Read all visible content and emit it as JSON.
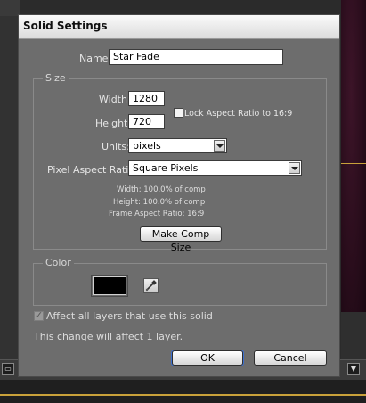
{
  "dialog": {
    "title": "Solid Settings",
    "name_label": "Name:",
    "name_value": "Star Fade"
  },
  "size": {
    "group_label": "Size",
    "width_label": "Width:",
    "width_value": "1280",
    "height_label": "Height:",
    "height_value": "720",
    "lock_label": "Lock Aspect Ratio to 16:9",
    "lock_checked": false,
    "units_label": "Units:",
    "units_value": "pixels",
    "par_label": "Pixel Aspect Ratio:",
    "par_value": "Square Pixels",
    "info_width": "Width:   100.0% of comp",
    "info_height": "Height:   100.0% of comp",
    "info_frame": "Frame Aspect Ratio: 16:9",
    "make_comp_size_label": "Make Comp Size"
  },
  "color": {
    "group_label": "Color",
    "swatch_color": "#000000",
    "eyedropper_icon": "eyedropper-icon"
  },
  "footer": {
    "affect_label": "Affect all layers that use this solid",
    "affect_checked": true,
    "change_note": "This change will affect 1 layer.",
    "ok_label": "OK",
    "cancel_label": "Cancel"
  },
  "background": {
    "accent_gold": "#c9a13a",
    "comp_color": "#2a0d1c"
  }
}
